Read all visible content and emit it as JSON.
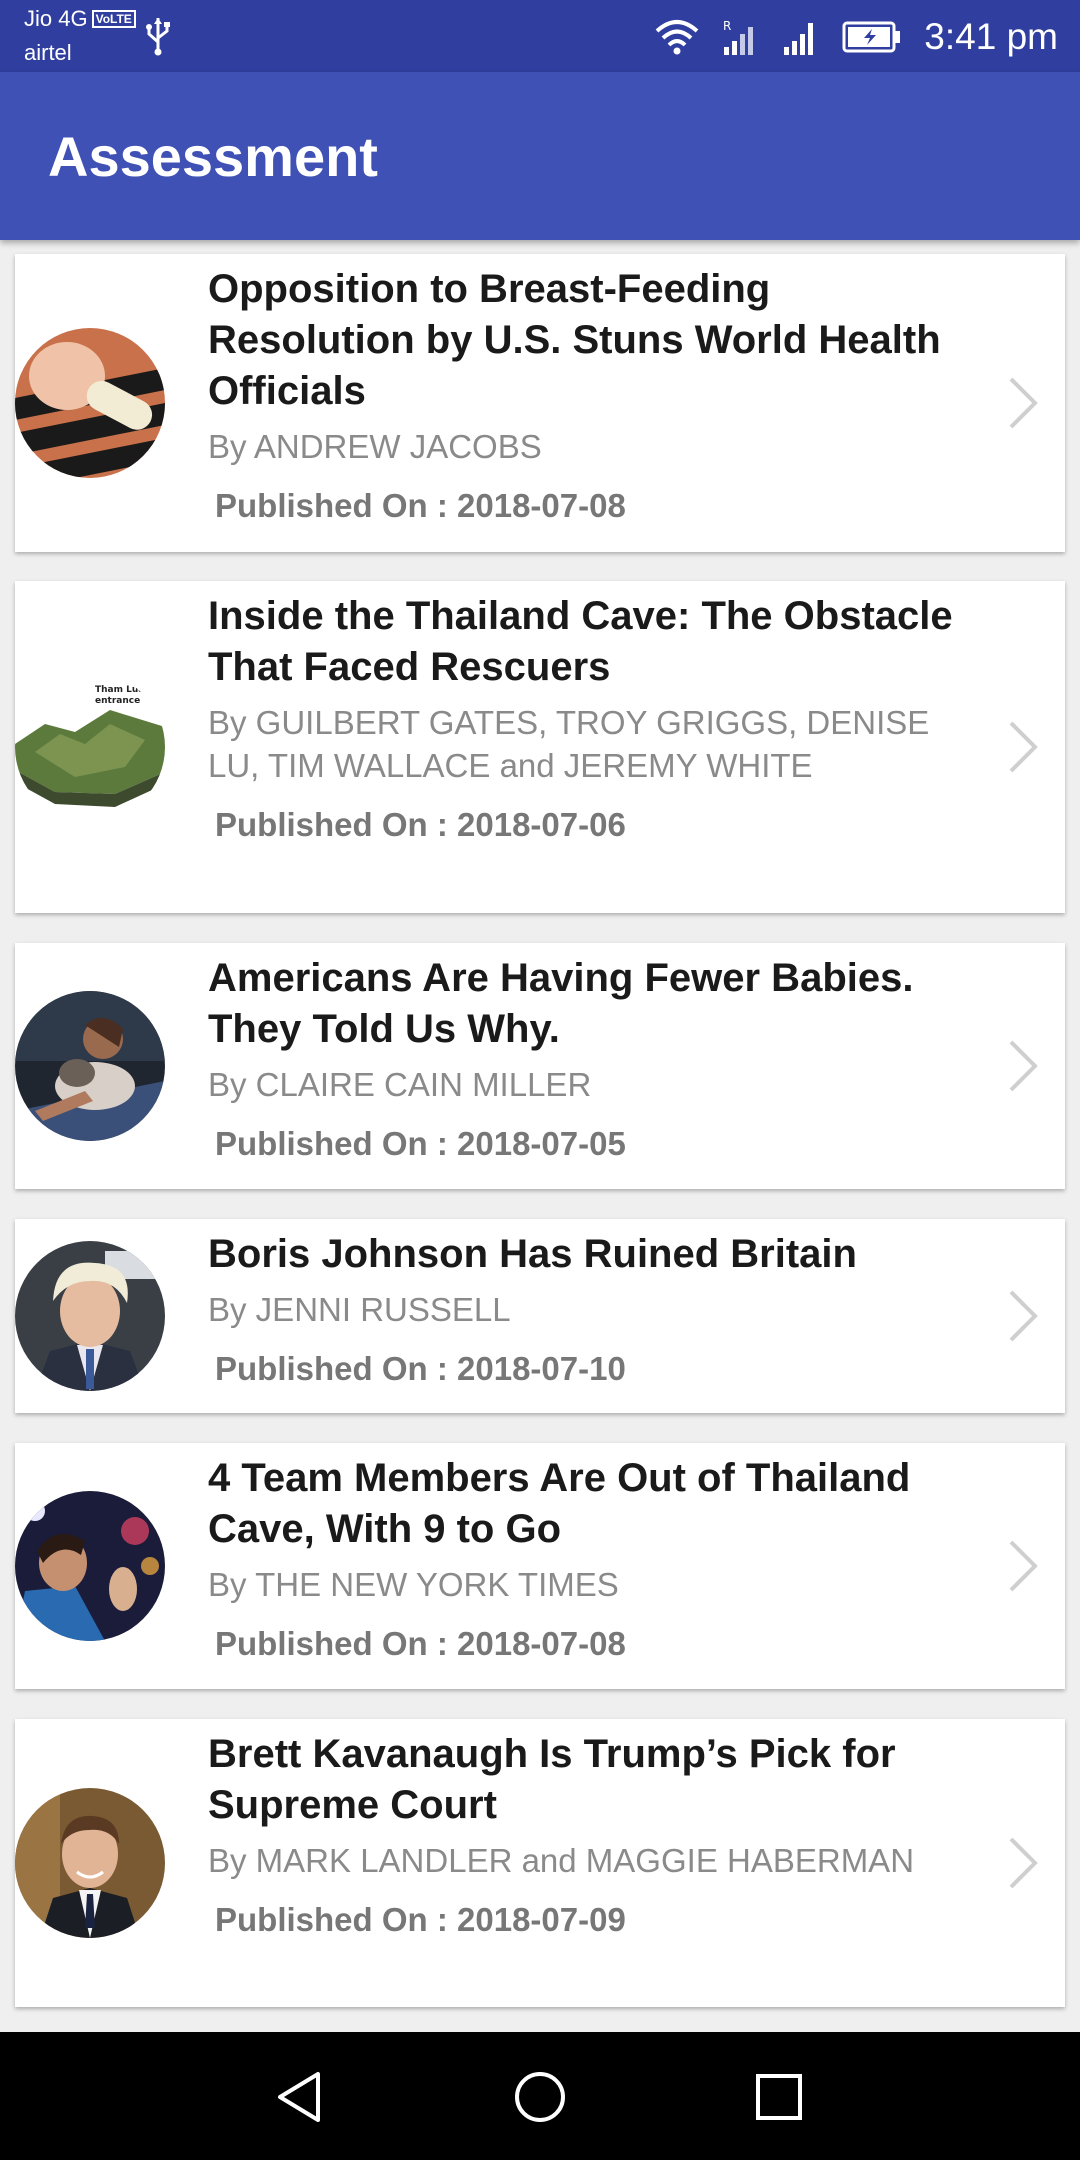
{
  "status_bar": {
    "carrier_1": "Jio 4G",
    "volte_badge": "VoLTE",
    "carrier_2": "airtel",
    "time": "3:41 pm"
  },
  "app_bar": {
    "title": "Assessment"
  },
  "articles": [
    {
      "title": "Opposition to Breast-Feeding Resolution by U.S. Stuns World Health Officials",
      "author": "By ANDREW JACOBS",
      "published": "Published On : 2018-07-08"
    },
    {
      "title": "Inside the Thailand Cave: The Obstacle That Faced Rescuers",
      "author": "By GUILBERT GATES, TROY GRIGGS, DENISE LU, TIM WALLACE and JEREMY WHITE",
      "published": "Published On : 2018-07-06",
      "thumb_labels": [
        "Tham Luang",
        "entrance"
      ]
    },
    {
      "title": "Americans Are Having Fewer Babies. They Told Us Why.",
      "author": "By CLAIRE CAIN MILLER",
      "published": "Published On : 2018-07-05"
    },
    {
      "title": "Boris Johnson Has Ruined Britain",
      "author": "By JENNI RUSSELL",
      "published": "Published On : 2018-07-10"
    },
    {
      "title": "4 Team Members Are Out of Thailand Cave, With 9 to Go",
      "author": "By THE NEW YORK TIMES",
      "published": "Published On : 2018-07-08"
    },
    {
      "title": "Brett Kavanaugh Is Trump’s Pick for Supreme Court",
      "author": "By MARK LANDLER and MAGGIE HABERMAN",
      "published": "Published On : 2018-07-09"
    }
  ],
  "icons": {
    "status": [
      "usb-icon",
      "wifi-icon",
      "signal-roaming-icon",
      "signal-icon",
      "battery-charging-icon"
    ],
    "chevron": "chevron-right-icon",
    "nav": [
      "back-icon",
      "home-icon",
      "recents-icon"
    ]
  },
  "colors": {
    "status_bar": "#303f9f",
    "app_bar": "#3f51b5",
    "background": "#efefef",
    "card": "#ffffff"
  }
}
